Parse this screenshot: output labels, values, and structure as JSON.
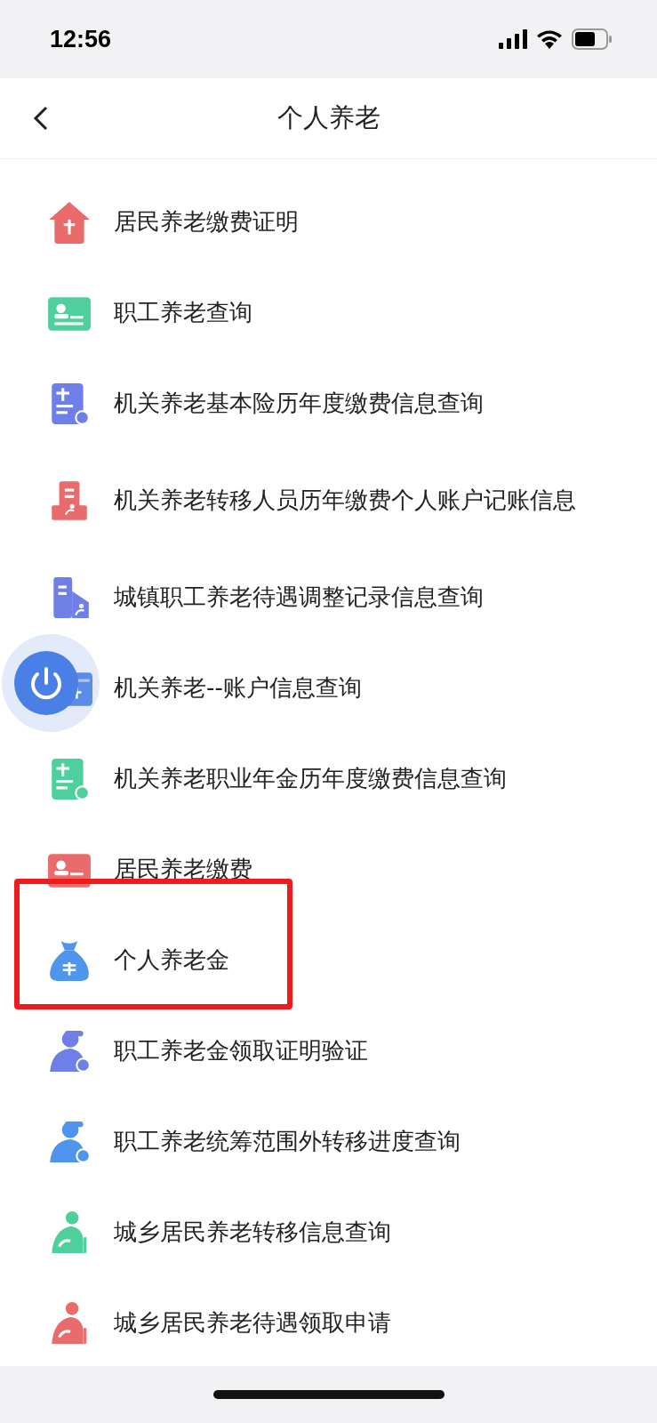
{
  "status_bar": {
    "time": "12:56"
  },
  "header": {
    "title": "个人养老"
  },
  "items": [
    {
      "label": "居民养老缴费证明",
      "kind": "house",
      "color": "#e96b6b",
      "highlighted": false
    },
    {
      "label": "职工养老查询",
      "kind": "card",
      "color": "#4fcf9c",
      "highlighted": false
    },
    {
      "label": "机关养老基本险历年度缴费信息查询",
      "kind": "doc",
      "color": "#6f7fe8",
      "highlighted": false
    },
    {
      "label": "机关养老转移人员历年缴费个人账户记账信息",
      "kind": "tower",
      "color": "#e96b6b",
      "highlighted": false
    },
    {
      "label": "城镇职工养老待遇调整记录信息查询",
      "kind": "building",
      "color": "#6f7fe8",
      "highlighted": false
    },
    {
      "label": "机关养老--账户信息查询",
      "kind": "wallet",
      "color": "#5b8de8",
      "highlighted": false
    },
    {
      "label": "机关养老职业年金历年度缴费信息查询",
      "kind": "doc",
      "color": "#4fcf9c",
      "highlighted": false
    },
    {
      "label": "居民养老缴费",
      "kind": "card",
      "color": "#e96b6b",
      "highlighted": false
    },
    {
      "label": "个人养老金",
      "kind": "bag",
      "color": "#4f95ee",
      "highlighted": true
    },
    {
      "label": "职工养老金领取证明验证",
      "kind": "person",
      "color": "#6f7fe8",
      "highlighted": false
    },
    {
      "label": "职工养老统筹范围外转移进度查询",
      "kind": "person",
      "color": "#4f95ee",
      "highlighted": false
    },
    {
      "label": "城乡居民养老转移信息查询",
      "kind": "elder",
      "color": "#4fcf9c",
      "highlighted": false
    },
    {
      "label": "城乡居民养老待遇领取申请",
      "kind": "elder",
      "color": "#e96b6b",
      "highlighted": false
    }
  ],
  "floating_button": {
    "visible": true
  }
}
